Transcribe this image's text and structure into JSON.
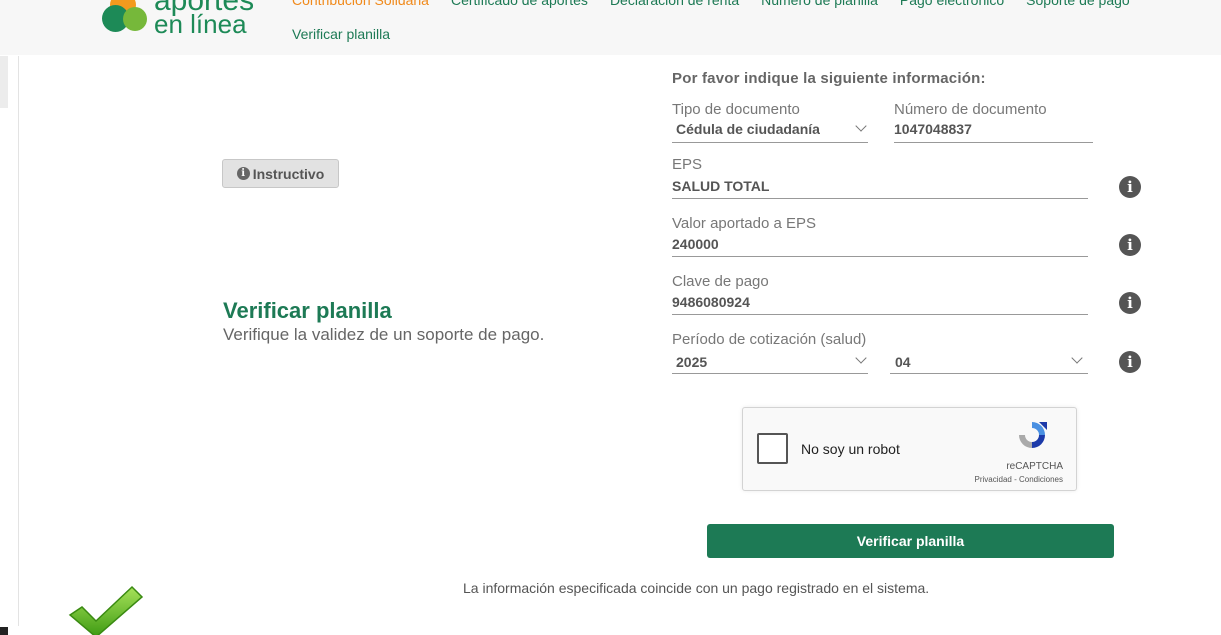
{
  "header": {
    "logo_top": "aportes",
    "logo_bottom": "en línea",
    "nav": [
      "Contribución Solidaria",
      "Certificado de aportes",
      "Declaración de renta",
      "Número de planilla",
      "Pago electrónico",
      "Soporte de pago"
    ],
    "nav_active_index": 0,
    "nav_second_row": "Verificar planilla"
  },
  "instructivo": {
    "label": "Instructivo",
    "icon": "info-icon"
  },
  "left": {
    "title": "Verificar planilla",
    "subtitle": "Verifique la validez de un soporte de pago."
  },
  "form": {
    "heading": "Por favor indique la siguiente información:",
    "doc_type": {
      "label": "Tipo de documento",
      "value": "Cédula de ciudadanía"
    },
    "doc_number": {
      "label": "Número de documento",
      "value": "1047048837"
    },
    "eps": {
      "label": "EPS",
      "value": "SALUD TOTAL"
    },
    "valor": {
      "label": "Valor aportado a EPS",
      "value": "240000"
    },
    "clave": {
      "label": "Clave de pago",
      "value": "9486080924"
    },
    "periodo": {
      "label": "Período de cotización (salud)",
      "year": "2025",
      "month": "04"
    }
  },
  "captcha": {
    "label": "No soy un robot",
    "brand": "reCAPTCHA",
    "terms": "Privacidad - Condiciones",
    "checked": false
  },
  "submit": {
    "label": "Verificar planilla"
  },
  "result": {
    "message": "La información especificada coincide con un pago registrado en el sistema."
  },
  "colors": {
    "primary": "#1d7a55",
    "accent": "#f08a1c",
    "success": "#5bbf1f"
  }
}
